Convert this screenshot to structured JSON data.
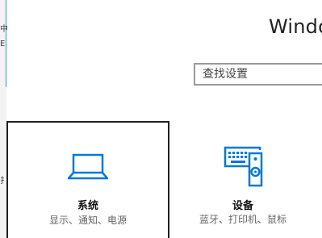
{
  "window": {
    "title": "Windo"
  },
  "behind_window": {
    "glyph_top": "中",
    "glyph_mid": "E",
    "glyph_bottom": "扌"
  },
  "search": {
    "placeholder": "查找设置"
  },
  "tiles": [
    {
      "label": "系统",
      "description": "显示、通知、电源",
      "icon": "laptop-icon",
      "selected": true
    },
    {
      "label": "设备",
      "description": "蓝牙、打印机、鼠标",
      "icon": "keyboard-speaker-icon",
      "selected": false
    }
  ],
  "colors": {
    "accent": "#0078d7",
    "selected_border": "#1f1f1f",
    "search_border": "#999999"
  }
}
